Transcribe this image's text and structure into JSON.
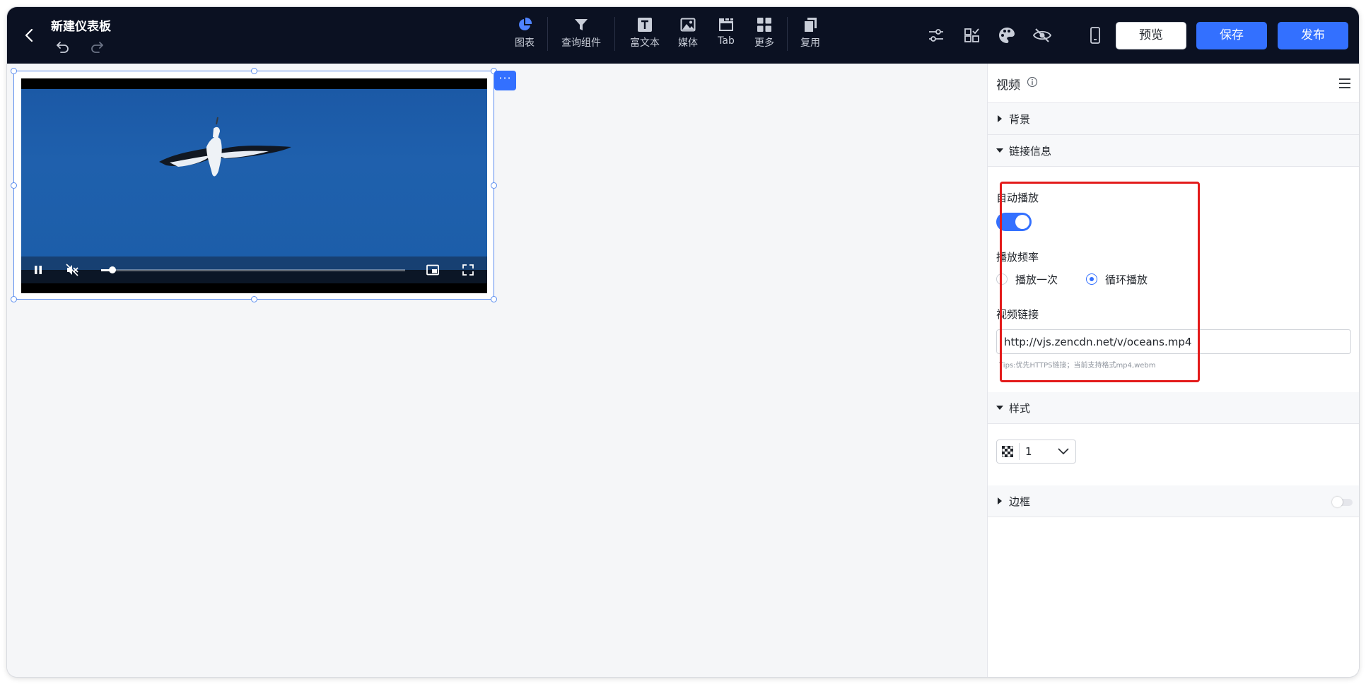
{
  "header": {
    "title": "新建仪表板",
    "toolbar": [
      {
        "label": "图表",
        "icon": "pie-chart-icon"
      },
      {
        "label": "查询组件",
        "icon": "filter-icon"
      },
      {
        "label": "富文本",
        "icon": "rich-text-icon"
      },
      {
        "label": "媒体",
        "icon": "image-icon"
      },
      {
        "label": "Tab",
        "icon": "tab-icon"
      },
      {
        "label": "更多",
        "icon": "grid-icon"
      },
      {
        "label": "复用",
        "icon": "copy-icon"
      }
    ],
    "right_icons": [
      "sliders-icon",
      "checklist-icon",
      "palette-icon",
      "eye-off-icon",
      "mobile-icon"
    ],
    "buttons": {
      "preview": "预览",
      "save": "保存",
      "publish": "发布"
    }
  },
  "canvas": {
    "video": {
      "playing": true,
      "muted": true,
      "progress": 0.03,
      "more_label": "···"
    }
  },
  "panel": {
    "title": "视频",
    "sections": {
      "background": "背景",
      "link_info": "链接信息",
      "style": "样式",
      "border": "边框"
    },
    "autoplay": {
      "label": "自动播放",
      "enabled": true
    },
    "play_frequency": {
      "label": "播放频率",
      "options": [
        "播放一次",
        "循环播放"
      ],
      "selected": "循环播放"
    },
    "video_link": {
      "label": "视频链接",
      "value": "http://vjs.zencdn.net/v/oceans.mp4",
      "tips": "Tips:优先HTTPS链接；当前支持格式mp4,webm"
    },
    "style": {
      "opacity_value": "1"
    },
    "border_enabled": false
  },
  "colors": {
    "topbar": "#0b1122",
    "accent": "#3370ff",
    "highlight": "#e31b1b"
  }
}
